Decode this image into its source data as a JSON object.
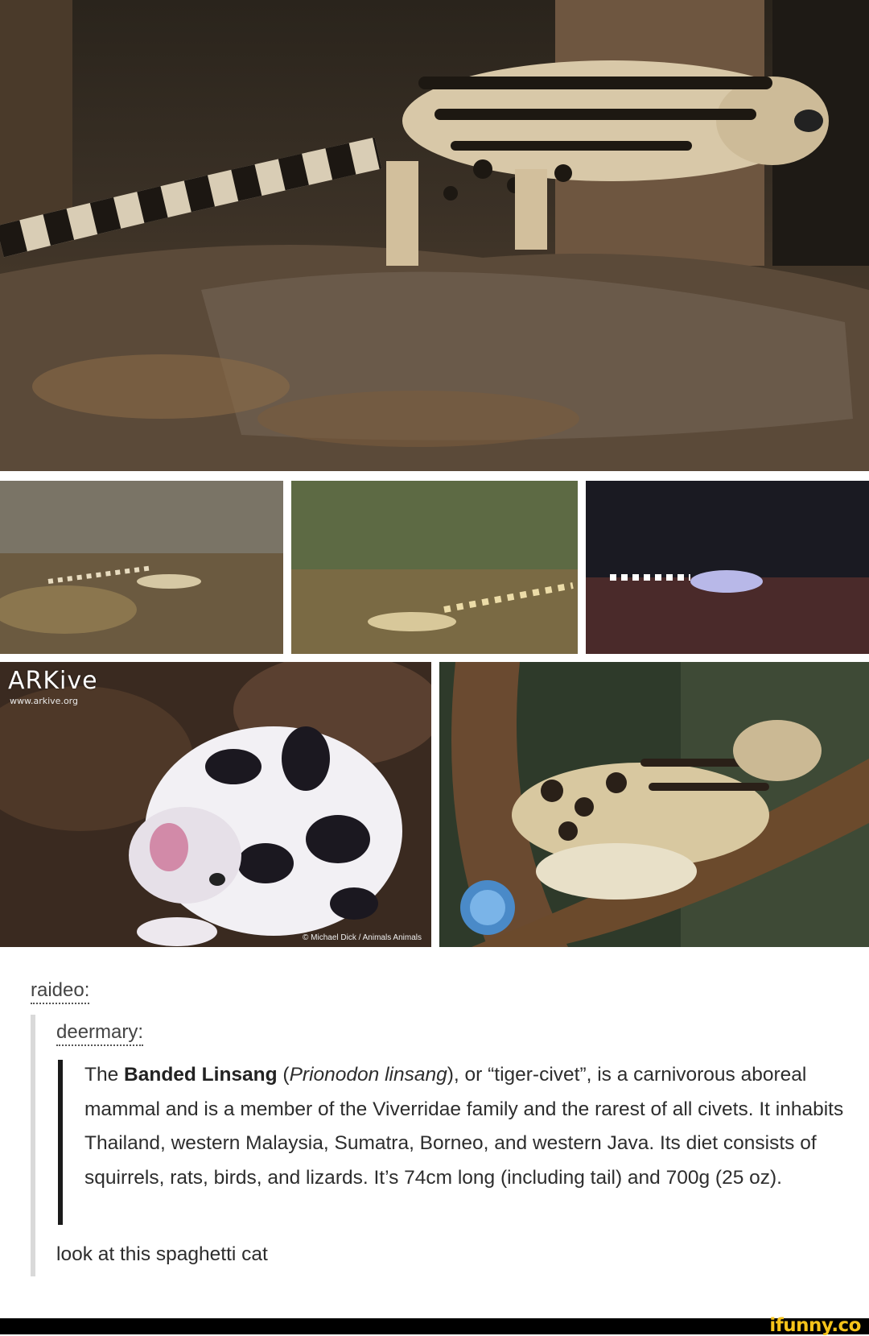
{
  "photos": {
    "top": {
      "alt": "banded linsang on tree root"
    },
    "cam1": {
      "alt": "trail camera night photo 1"
    },
    "cam2": {
      "alt": "trail camera night photo 2"
    },
    "cam3": {
      "alt": "trail camera night photo 3"
    },
    "arkive": {
      "logo_text": "ARKive",
      "url_text": "www.arkive.org",
      "credit": "© Michael Dick / Animals Animals"
    },
    "branch": {
      "alt": "linsang on branch"
    }
  },
  "post": {
    "reblogger": "raideo:",
    "source_user": "deermary:",
    "quote": {
      "part1": "The ",
      "bold_name": "Banded Linsang",
      "part2": " (",
      "italic_name": "Prionodon linsang",
      "part3": "), or “tiger-civet”, is a carnivorous aboreal mammal and is a member of the Viverridae family and the rarest of all civets. It inhabits Thailand, western Malaysia, Sumatra, Borneo, and western Java. Its diet consists of squirrels, rats, birds, and lizards. It’s 74cm long (including tail) and 700g (25 oz)."
    },
    "reply": "look at this spaghetti cat"
  },
  "footer": {
    "brand": "ifunny.co"
  },
  "colors": {
    "background": "#ffffff",
    "footer": "#000000",
    "brand": "#f5c31a"
  }
}
